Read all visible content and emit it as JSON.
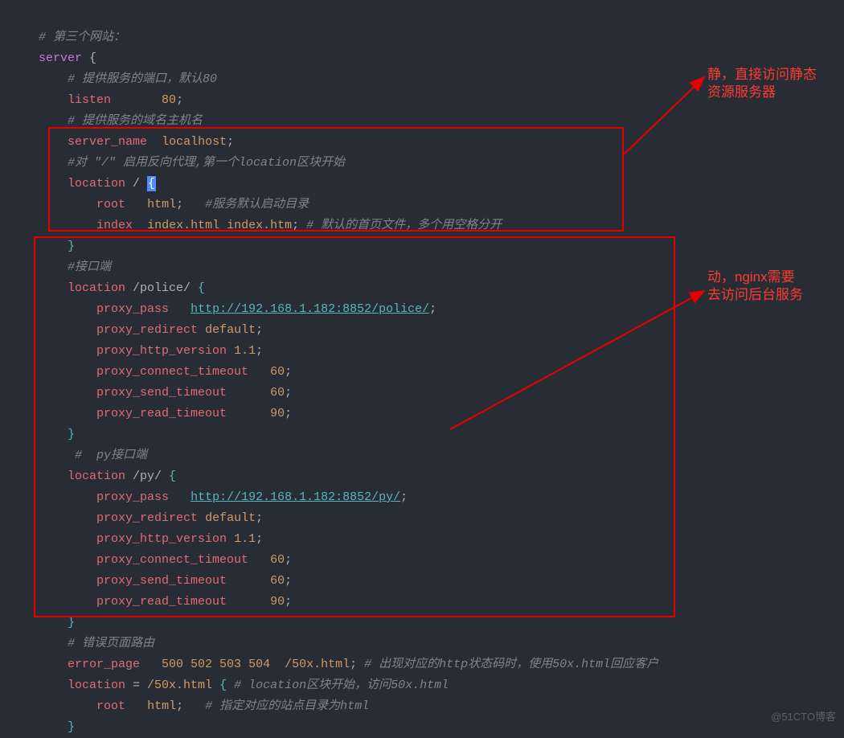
{
  "code": {
    "l1": "# 第三个网站：",
    "l2k": "server",
    "l2p": " {",
    "l3": "# 提供服务的端口，默认80",
    "l4d": "listen",
    "l4v": "80",
    "l4s": ";",
    "l5": "# 提供服务的域名主机名",
    "l6d": "server_name",
    "l6v": "localhost",
    "l6s": ";",
    "l7": "#对 \"/\" 启用反向代理,第一个location区块开始",
    "l8d": "location",
    "l8p": " / ",
    "l8b": "{",
    "l9d": "root",
    "l9v": "html",
    "l9s": ";",
    "l9c": "#服务默认启动目录",
    "l10d": "index",
    "l10v": "index.html index.htm",
    "l10s": ";",
    "l10c": "# 默认的首页文件，多个用空格分开",
    "l11b": "}",
    "l12": "#接口端",
    "l13d": "location",
    "l13p": " /police/ ",
    "l13b": "{",
    "l14d": "proxy_pass",
    "l14u": "http://192.168.1.182:8852/police/",
    "l14s": ";",
    "l15d": "proxy_redirect",
    "l15v": "default",
    "l15s": ";",
    "l16d": "proxy_http_version",
    "l16v": "1.1",
    "l16s": ";",
    "l17d": "proxy_connect_timeout",
    "l17v": "60",
    "l17s": ";",
    "l18d": "proxy_send_timeout",
    "l18v": "60",
    "l18s": ";",
    "l19d": "proxy_read_timeout",
    "l19v": "90",
    "l19s": ";",
    "l20b": "}",
    "l21": "#  py接口端",
    "l22d": "location",
    "l22p": " /py/ ",
    "l22b": "{",
    "l23d": "proxy_pass",
    "l23u": "http://192.168.1.182:8852/py/",
    "l23s": ";",
    "l24d": "proxy_redirect",
    "l24v": "default",
    "l24s": ";",
    "l25d": "proxy_http_version",
    "l25v": "1.1",
    "l25s": ";",
    "l26d": "proxy_connect_timeout",
    "l26v": "60",
    "l26s": ";",
    "l27d": "proxy_send_timeout",
    "l27v": "60",
    "l27s": ";",
    "l28d": "proxy_read_timeout",
    "l28v": "90",
    "l28s": ";",
    "l29b": "}",
    "l30": "# 错误页面路由",
    "l31d": "error_page",
    "l31v": "500 502 503 504  /50x.html",
    "l31s": ";",
    "l31c": "# 出现对应的http状态码时，使用50x.html回应客户",
    "l32d": "location",
    "l32e": " = ",
    "l32p": "/50x.html",
    "l32b": "{",
    "l32c": "# location区块开始，访问50x.html",
    "l33d": "root",
    "l33v": "html",
    "l33s": ";",
    "l33c": "# 指定对应的站点目录为html",
    "l34b": "}"
  },
  "annotations": {
    "top1": "静，直接访问静态",
    "top2": "资源服务器",
    "bot1": "动，nginx需要",
    "bot2": "去访问后台服务"
  },
  "watermark": "@51CTO博客"
}
